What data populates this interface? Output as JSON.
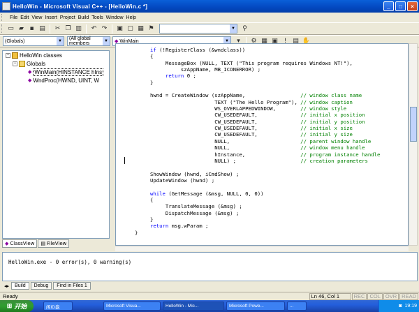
{
  "window": {
    "title": "HelloWin - Microsoft Visual C++ - [HelloWin.c *]"
  },
  "menu": [
    "File",
    "Edit",
    "View",
    "Insert",
    "Project",
    "Build",
    "Tools",
    "Window",
    "Help"
  ],
  "toolbar2": {
    "scope": "(Globals)",
    "members": "(All global members",
    "function": "WinMain"
  },
  "classview": {
    "root": "HelloWin classes",
    "folder": "Globals",
    "items": [
      "WinMain(HINSTANCE hIns",
      "WndProc(HWND, UINT, W"
    ]
  },
  "left_tabs": [
    "ClassView",
    "FileView"
  ],
  "code_lines": [
    [
      "     ",
      {
        "k": "if"
      },
      " (!RegisterClass (&wndclass))"
    ],
    [
      "     {"
    ],
    [
      "          MessageBox (NULL, TEXT (\"This program requires Windows NT!\"),"
    ],
    [
      "               szAppName, MB_ICONERROR) ;"
    ],
    [
      "          ",
      {
        "k": "return"
      },
      " 0 ;"
    ],
    [
      "     }"
    ],
    [
      ""
    ],
    [
      "     hwnd = CreateWindow (szAppName,                  ",
      {
        "c": "// window class name"
      }
    ],
    [
      "                          TEXT (\"The Hello Program\"), ",
      {
        "c": "// window caption"
      }
    ],
    [
      "                          WS_OVERLAPPEDWINDOW,        ",
      {
        "c": "// window style"
      }
    ],
    [
      "                          CW_USEDEFAULT,              ",
      {
        "c": "// initial x position"
      }
    ],
    [
      "                          CW_USEDEFAULT,              ",
      {
        "c": "// initial y position"
      }
    ],
    [
      "                          CW_USEDEFAULT,              ",
      {
        "c": "// initial x size"
      }
    ],
    [
      "                          CW_USEDEFAULT,              ",
      {
        "c": "// initial y size"
      }
    ],
    [
      "                          NULL,                       ",
      {
        "c": "// parent window handle"
      }
    ],
    [
      "                          NULL,                       ",
      {
        "c": "// window menu handle"
      }
    ],
    [
      "                          hInstance,                  ",
      {
        "c": "// program instance handle"
      }
    ],
    [
      "                          NULL) ;                     ",
      {
        "c": "// creation parameters"
      }
    ],
    [
      ""
    ],
    [
      "     ShowWindow (hwnd, iCmdShow) ;"
    ],
    [
      "     UpdateWindow (hwnd) ;"
    ],
    [
      ""
    ],
    [
      "     ",
      {
        "k": "while"
      },
      " (GetMessage (&msg, NULL, 0, 0))"
    ],
    [
      "     {"
    ],
    [
      "          TranslateMessage (&msg) ;"
    ],
    [
      "          DispatchMessage (&msg) ;"
    ],
    [
      "     }"
    ],
    [
      "     ",
      {
        "k": "return"
      },
      " msg.wParam ;"
    ],
    [
      "}"
    ]
  ],
  "output": {
    "text": "HelloWin.exe - 0 error(s), 0 warning(s)"
  },
  "output_tabs": [
    "Build",
    "Debug",
    "Find in Files 1"
  ],
  "status": {
    "left": "Ready",
    "pos": "Ln 46, Col 1",
    "flags": [
      "REC",
      "COL",
      "OVR",
      "READ"
    ]
  },
  "taskbar": {
    "start": "开始",
    "tasks": [
      "闲ID盘",
      "Microsoft Visua...",
      "HelloWin - Mic...",
      "Microsoft Powe...",
      "..."
    ],
    "clock": "19:19"
  },
  "colors": {
    "keyword": "#0000ff",
    "comment": "#008000"
  }
}
